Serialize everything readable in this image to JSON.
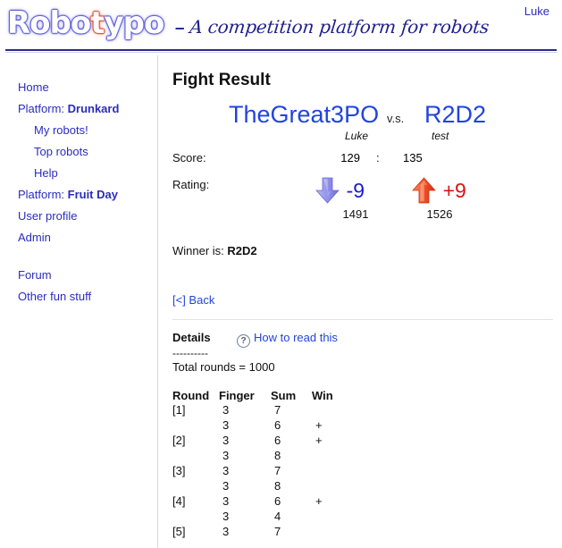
{
  "header": {
    "logo_pre": "Robo",
    "logo_hot": "t",
    "logo_post": "ypo",
    "dash": "–",
    "tagline": "A competition platform for robots",
    "user_link": "Luke"
  },
  "sidebar": {
    "items": [
      {
        "label": "Home",
        "type": "link",
        "indent": false
      },
      {
        "prefix": "Platform: ",
        "label": "Drunkard",
        "type": "platform",
        "indent": false
      },
      {
        "label": "My robots!",
        "type": "link",
        "indent": true
      },
      {
        "label": "Top robots",
        "type": "link",
        "indent": true
      },
      {
        "label": "Help",
        "type": "link",
        "indent": true
      },
      {
        "prefix": "Platform: ",
        "label": "Fruit Day",
        "type": "platform",
        "indent": false
      },
      {
        "label": "User profile",
        "type": "link",
        "indent": false
      },
      {
        "label": "Admin",
        "type": "link",
        "indent": false
      },
      {
        "label": "Forum",
        "type": "link",
        "indent": false,
        "gap": true
      },
      {
        "label": "Other fun stuff",
        "type": "link",
        "indent": false
      }
    ]
  },
  "main": {
    "page_title": "Fight Result",
    "fight": {
      "left_robot": "TheGreat3PO",
      "left_owner": "Luke",
      "vs_label": "v.s.",
      "right_robot": "R2D2",
      "right_owner": "test"
    },
    "score": {
      "label": "Score:",
      "left": "129",
      "separator": ":",
      "right": "135"
    },
    "rating": {
      "label": "Rating:",
      "left_arrow": "arrow-down-icon",
      "left_delta": "-9",
      "left_value": "1491",
      "right_arrow": "arrow-up-icon",
      "right_delta": "+9",
      "right_value": "1526"
    },
    "winner": {
      "label": "Winner is:",
      "name": "R2D2"
    },
    "back_link": "[<] Back",
    "details": {
      "title": "Details",
      "howto_icon": "question-circle-icon",
      "howto_label": "How to read this",
      "dashes": "----------",
      "total_rounds": "Total rounds = 1000",
      "columns": [
        "Round",
        "Finger",
        "Sum",
        "Win"
      ],
      "rows": [
        {
          "round": "[1]",
          "finger": "3",
          "sum": "7",
          "win": ""
        },
        {
          "round": "",
          "finger": "3",
          "sum": "6",
          "win": "+"
        },
        {
          "round": "[2]",
          "finger": "3",
          "sum": "6",
          "win": "+"
        },
        {
          "round": "",
          "finger": "3",
          "sum": "8",
          "win": ""
        },
        {
          "round": "[3]",
          "finger": "3",
          "sum": "7",
          "win": ""
        },
        {
          "round": "",
          "finger": "3",
          "sum": "8",
          "win": ""
        },
        {
          "round": "[4]",
          "finger": "3",
          "sum": "6",
          "win": "+"
        },
        {
          "round": "",
          "finger": "3",
          "sum": "4",
          "win": ""
        },
        {
          "round": "[5]",
          "finger": "3",
          "sum": "7",
          "win": ""
        }
      ]
    }
  },
  "colors": {
    "link": "#2244dd",
    "sidebar_link": "#2b2bc0",
    "negative": "#1a1ad0",
    "positive": "#d81414",
    "rule": "#2a2a8c",
    "logo_blue": "#4a4ad0",
    "logo_red": "#d8391f"
  }
}
